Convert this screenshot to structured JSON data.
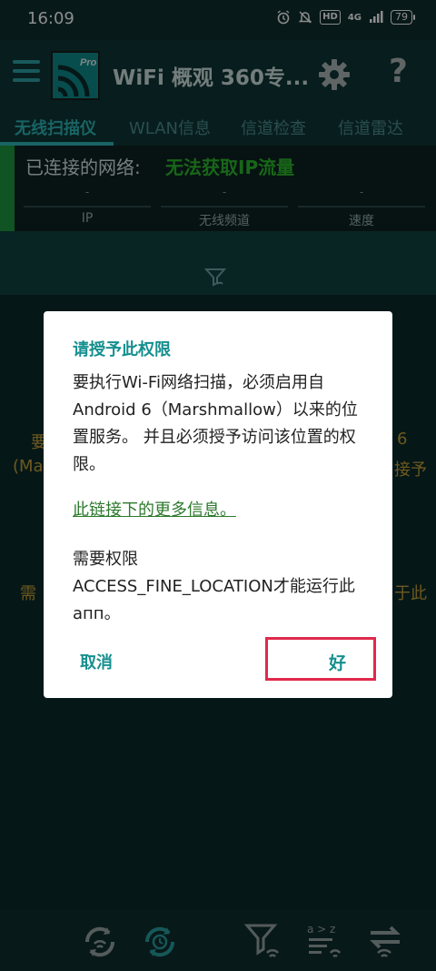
{
  "status_bar": {
    "time": "16:09",
    "hd": "HD",
    "network": "4G",
    "battery": "79"
  },
  "app_bar": {
    "title": "WiFi 概观 360专...",
    "help": "?"
  },
  "tabs": [
    {
      "label": "无线扫描仪"
    },
    {
      "label": "WLAN信息"
    },
    {
      "label": "信道检查"
    },
    {
      "label": "信道雷达"
    }
  ],
  "connection": {
    "label": "已连接的网络:",
    "status": "无法获取IP流量",
    "metrics": [
      {
        "value": "-",
        "label": "IP"
      },
      {
        "value": "-",
        "label": "无线频道"
      },
      {
        "value": "-",
        "label": "速度"
      }
    ]
  },
  "background": {
    "left1": "要",
    "left2": "(Ma",
    "right1": "6",
    "right2": "接予",
    "left3": "需",
    "right3": "于此"
  },
  "dialog": {
    "title": "请授予此权限",
    "message": "要执行Wi-Fi网络扫描，必须启用自Android 6（Marshmallow）以来的位置服务。 并且必须授予访问该位置的权限。",
    "link": "此链接下的更多信息。",
    "requirement_line1": "需要权限",
    "requirement_line2": "ACCESS_FINE_LOCATION才能运行此апп。",
    "cancel_label": "取消",
    "ok_label": "好"
  },
  "bottom_bar": {
    "icons": [
      "refresh-wifi-icon",
      "refresh-clock-icon",
      "filter-wifi-icon",
      "sort-az-icon",
      "swap-wifi-icon"
    ],
    "sort_label": "a > z"
  },
  "colors": {
    "accent": "#168f8f",
    "ok_highlight": "#e0294c",
    "connected_bar": "#1d9a3f",
    "status_green": "#2dbb2d"
  }
}
